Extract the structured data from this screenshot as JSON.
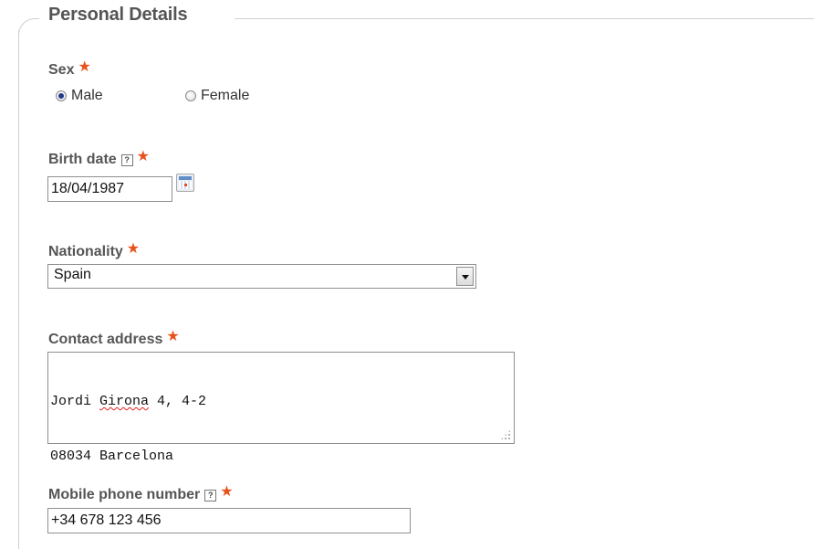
{
  "form": {
    "section_title": "Personal Details",
    "required_mark": "★",
    "help_mark": "?",
    "accent_color": "#e8521c"
  },
  "sex": {
    "label": "Sex",
    "options": [
      {
        "label": "Male",
        "checked": true
      },
      {
        "label": "Female",
        "checked": false
      }
    ]
  },
  "birth_date": {
    "label": "Birth date",
    "value": "18/04/1987",
    "calendar_icon": "calendar-icon"
  },
  "nationality": {
    "label": "Nationality",
    "selected": "Spain"
  },
  "contact_address": {
    "label": "Contact address",
    "lines": [
      "Jordi Girona 4, 4-2",
      "08034 Barcelona"
    ],
    "misspelled_word": "Girona",
    "line1_prefix": "Jordi ",
    "line1_suffix": " 4, 4-2"
  },
  "mobile_phone": {
    "label": "Mobile phone number",
    "value": "+34 678 123 456"
  }
}
